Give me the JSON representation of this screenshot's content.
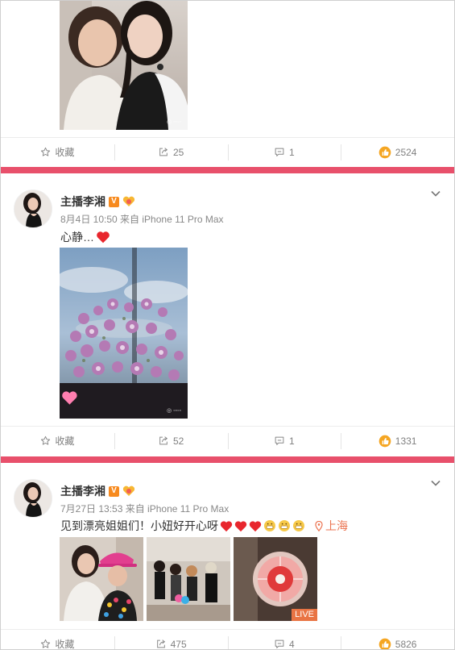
{
  "accent": "#e8506b",
  "post_top": {
    "actions": {
      "favorite_label": "收藏",
      "repost_count": "25",
      "comment_count": "1",
      "like_count": "2524"
    }
  },
  "post_1": {
    "username": "主播李湘",
    "verified_badge": "V",
    "meta": "8月4日 10:50 来自 iPhone 11 Pro Max",
    "text": "心静…",
    "actions": {
      "favorite_label": "收藏",
      "repost_count": "52",
      "comment_count": "1",
      "like_count": "1331"
    }
  },
  "post_2": {
    "username": "主播李湘",
    "verified_badge": "V",
    "meta": "7月27日 13:53 来自 iPhone 11 Pro Max",
    "text": "见到漂亮姐姐们！小妞好开心呀",
    "location": "上海",
    "live_badge": "LIVE",
    "actions": {
      "favorite_label": "收藏",
      "repost_count": "475",
      "comment_count": "4",
      "like_count": "5826"
    }
  }
}
